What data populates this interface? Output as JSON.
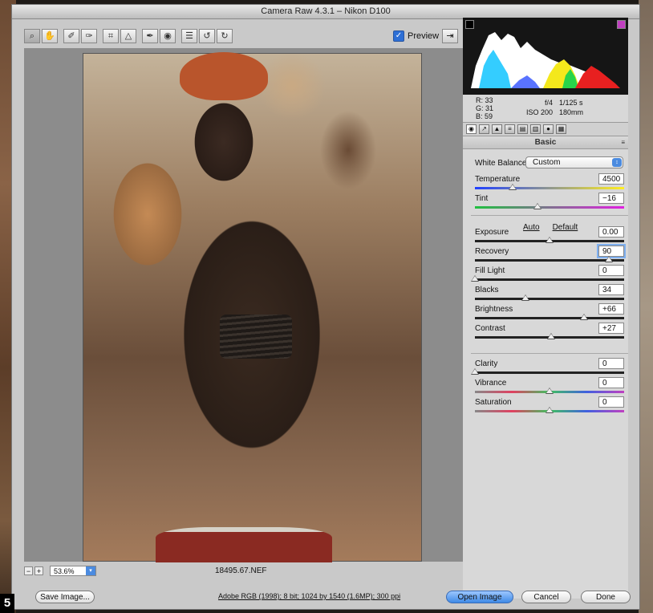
{
  "window": {
    "title": "Camera Raw 4.3.1 – Nikon D100"
  },
  "toolbar": {
    "tools": [
      {
        "name": "zoom-tool-icon",
        "glyph": "⌕"
      },
      {
        "name": "hand-tool-icon",
        "glyph": "✋"
      },
      {
        "name": "white-balance-tool-icon",
        "glyph": "✐"
      },
      {
        "name": "color-sampler-tool-icon",
        "glyph": "✑"
      },
      {
        "name": "crop-tool-icon",
        "glyph": "⌗"
      },
      {
        "name": "straighten-tool-icon",
        "glyph": "△"
      },
      {
        "name": "retouch-tool-icon",
        "glyph": "✒"
      },
      {
        "name": "red-eye-tool-icon",
        "glyph": "◉"
      },
      {
        "name": "preferences-icon",
        "glyph": "☰"
      },
      {
        "name": "rotate-left-icon",
        "glyph": "↺"
      },
      {
        "name": "rotate-right-icon",
        "glyph": "↻"
      }
    ],
    "preview_label": "Preview",
    "preview_checked": "✓",
    "fullscreen_glyph": "⇥"
  },
  "status": {
    "zoom_out": "−",
    "zoom_in": "+",
    "zoom": "53.6%",
    "zoom_arrow": "▾",
    "filename": "18495.67.NEF"
  },
  "histogram": {
    "colors": [
      "#ffffff",
      "#00e5ff",
      "#ffff00",
      "#ff2020",
      "#3050ff",
      "#20ff40",
      "#ff40ff"
    ]
  },
  "readout": {
    "r_label": "R:",
    "r": "33",
    "g_label": "G:",
    "g": "31",
    "b_label": "B:",
    "b": "59",
    "aperture": "f/4",
    "shutter": "1/125 s",
    "iso": "ISO 200",
    "focal": "180mm"
  },
  "panel": {
    "title": "Basic",
    "menu_glyph": "≡",
    "tabs": [
      {
        "name": "basic-tab-icon",
        "glyph": "◉"
      },
      {
        "name": "tone-curve-tab-icon",
        "glyph": "↗"
      },
      {
        "name": "detail-tab-icon",
        "glyph": "▲"
      },
      {
        "name": "hsl-tab-icon",
        "glyph": "≡"
      },
      {
        "name": "split-toning-tab-icon",
        "glyph": "▤"
      },
      {
        "name": "lens-corrections-tab-icon",
        "glyph": "▥"
      },
      {
        "name": "camera-calibration-tab-icon",
        "glyph": "●"
      },
      {
        "name": "presets-tab-icon",
        "glyph": "▦"
      }
    ],
    "white_balance_label": "White Balance:",
    "white_balance_value": "Custom",
    "white_balance_arrow": "↕",
    "auto_label": "Auto",
    "default_label": "Default",
    "sliders": [
      {
        "label": "Temperature",
        "value": "4500",
        "pos": 0.25
      },
      {
        "label": "Tint",
        "value": "−16",
        "pos": 0.42
      },
      {
        "label": "Exposure",
        "value": "0.00",
        "pos": 0.5
      },
      {
        "label": "Recovery",
        "value": "90",
        "pos": 0.9
      },
      {
        "label": "Fill Light",
        "value": "0",
        "pos": 0.0
      },
      {
        "label": "Blacks",
        "value": "34",
        "pos": 0.34
      },
      {
        "label": "Brightness",
        "value": "+66",
        "pos": 0.73
      },
      {
        "label": "Contrast",
        "value": "+27",
        "pos": 0.51
      },
      {
        "label": "Clarity",
        "value": "0",
        "pos": 0.0
      },
      {
        "label": "Vibrance",
        "value": "0",
        "pos": 0.5
      },
      {
        "label": "Saturation",
        "value": "0",
        "pos": 0.5
      }
    ]
  },
  "bottom": {
    "save_label": "Save Image...",
    "workflow_info": "Adobe RGB (1998); 8 bit; 1024 by 1540 (1.6MP); 300 ppi",
    "open_label": "Open Image",
    "cancel_label": "Cancel",
    "done_label": "Done"
  },
  "step_badge": "5"
}
